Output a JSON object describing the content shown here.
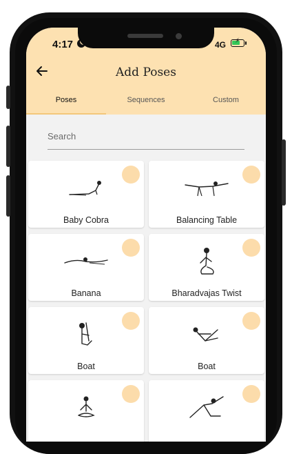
{
  "status_bar": {
    "time": "4:17",
    "network": "4G"
  },
  "header": {
    "title": "Add Poses"
  },
  "tabs": [
    {
      "label": "Poses",
      "active": true
    },
    {
      "label": "Sequences",
      "active": false
    },
    {
      "label": "Custom",
      "active": false
    }
  ],
  "search": {
    "placeholder": "Search",
    "value": ""
  },
  "poses": [
    {
      "name": "Baby Cobra",
      "icon": "baby-cobra-pose-icon"
    },
    {
      "name": "Balancing Table",
      "icon": "balancing-table-pose-icon"
    },
    {
      "name": "Banana",
      "icon": "banana-pose-icon"
    },
    {
      "name": "Bharadvajas Twist",
      "icon": "bharadvajas-twist-pose-icon"
    },
    {
      "name": "Boat",
      "icon": "boat-pose-icon"
    },
    {
      "name": "Boat",
      "icon": "boat-pose-icon"
    },
    {
      "name": "",
      "icon": "seated-meditation-pose-icon"
    },
    {
      "name": "",
      "icon": "side-angle-pose-icon"
    }
  ],
  "colors": {
    "header": "#fde1b1",
    "add_button": "#fcdcab",
    "active_tab_underline": "#f3c77a"
  }
}
